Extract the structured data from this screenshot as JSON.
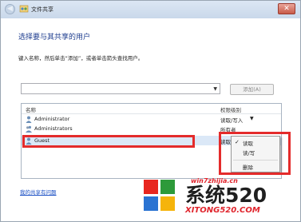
{
  "window": {
    "title": "文件共享",
    "close_label": "✕",
    "back_label": "◀"
  },
  "main": {
    "heading": "选择要与其共享的用户",
    "instructions": "键入名称，然后单击“添加”，或者单击箭头查找用户。",
    "name_input_value": "",
    "add_button_label": "添加(A)"
  },
  "table": {
    "headers": {
      "name": "名称",
      "permission": "权限级别"
    },
    "rows": [
      {
        "name": "Administrator",
        "permission": "读取/写入",
        "has_dropdown": true
      },
      {
        "name": "Administrators",
        "permission": "所有者",
        "has_dropdown": false
      },
      {
        "name": "Guest",
        "permission": "读取",
        "has_dropdown": true,
        "selected": true
      }
    ]
  },
  "permission_menu": {
    "items": [
      {
        "label": "读取",
        "checked": true
      },
      {
        "label": "读/写",
        "checked": false
      },
      {
        "label": "删除",
        "checked": false
      }
    ],
    "check_glyph": "✓"
  },
  "footer": {
    "help_link": "我的共享有问题"
  },
  "watermark": {
    "url_text": "win7zhijia.cn",
    "logo_text": "系统520",
    "logo_domain": "XITONG520.COM"
  },
  "colors": {
    "annotation_red": "#e42b2b",
    "link_blue": "#1a4fc4",
    "heading_blue": "#1e3d8f"
  }
}
